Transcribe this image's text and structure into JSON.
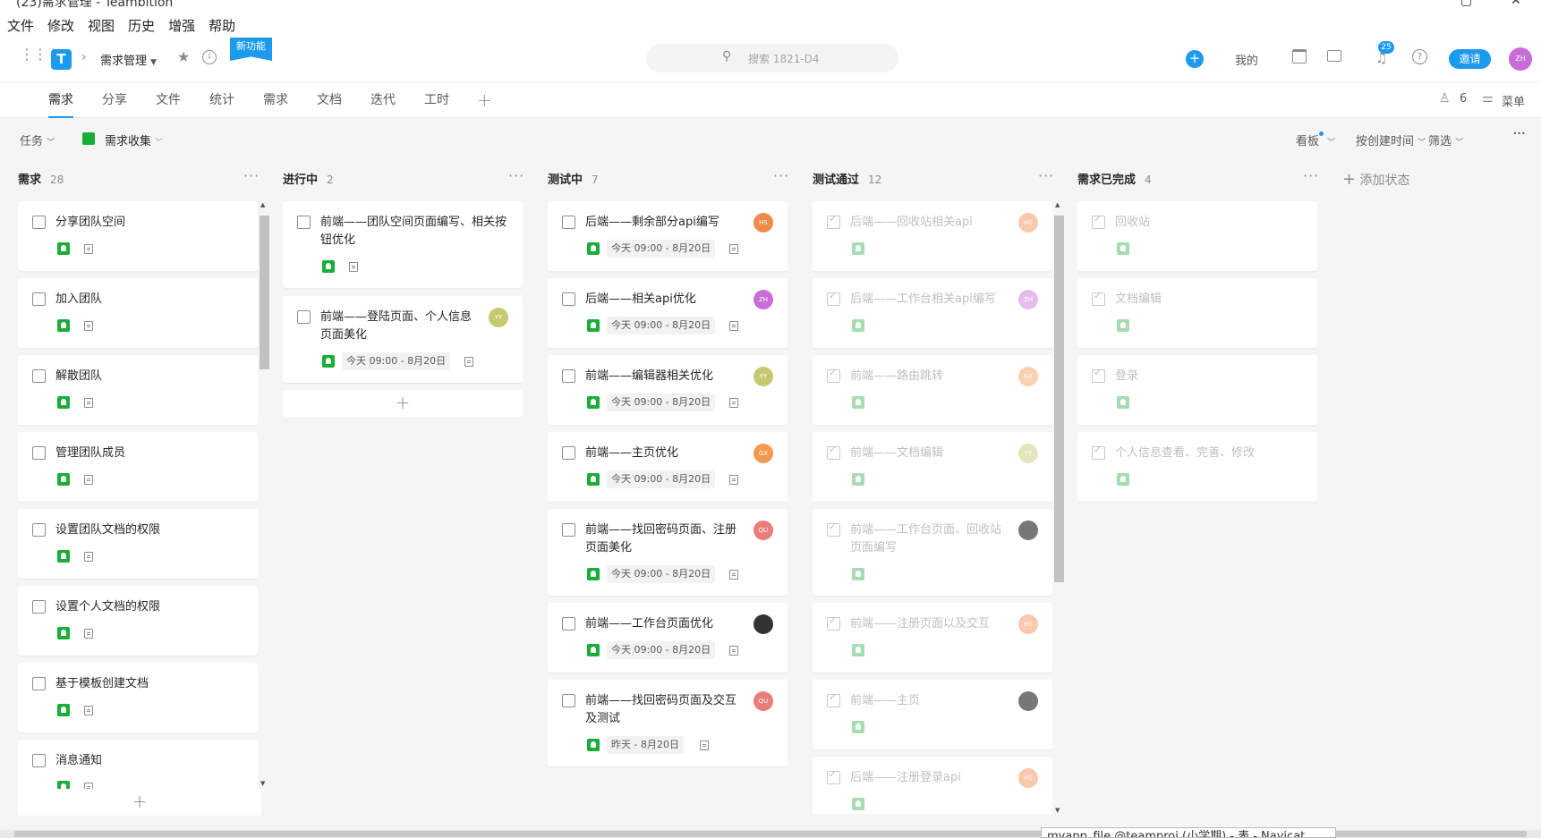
{
  "window": {
    "title": "(23)需求管理 - Teambition"
  },
  "menu": [
    "文件",
    "修改",
    "视图",
    "历史",
    "增强",
    "帮助"
  ],
  "header": {
    "project": "需求管理",
    "new_feature": "新功能",
    "search_placeholder": "搜索 1821-D4",
    "mine": "我的",
    "notification_count": "25",
    "invite": "邀请",
    "avatar": "ZH"
  },
  "tabs": [
    "需求",
    "分享",
    "文件",
    "统计",
    "需求",
    "文档",
    "迭代",
    "工时"
  ],
  "tab_right": {
    "members_count": "6",
    "menu_label": "菜单"
  },
  "toolbar": {
    "task_label": "任务",
    "collection_label": "需求收集",
    "view_label": "看板",
    "sort_label": "按创建时间",
    "filter_label": "筛选"
  },
  "add_status": "添加状态",
  "columns": [
    {
      "title": "需求",
      "count": "28",
      "cards": [
        {
          "title": "分享团队空间"
        },
        {
          "title": "加入团队"
        },
        {
          "title": "解散团队"
        },
        {
          "title": "管理团队成员"
        },
        {
          "title": "设置团队文档的权限"
        },
        {
          "title": "设置个人文档的权限"
        },
        {
          "title": "基于模板创建文档"
        },
        {
          "title": "消息通知"
        }
      ]
    },
    {
      "title": "进行中",
      "count": "2",
      "cards": [
        {
          "title": "前端——团队空间页面编写、相关按钮优化"
        },
        {
          "title": "前端——登陆页面、个人信息页面美化",
          "avatar": "YY",
          "date": "今天 09:00 - 8月20日"
        }
      ]
    },
    {
      "title": "测试中",
      "count": "7",
      "cards": [
        {
          "title": "后端——剩余部分api编写",
          "avatar": "HS",
          "date": "今天 09:00 - 8月20日"
        },
        {
          "title": "后端——相关api优化",
          "avatar": "ZH",
          "date": "今天 09:00 - 8月20日"
        },
        {
          "title": "前端——编辑器相关优化",
          "avatar": "YY",
          "date": "今天 09:00 - 8月20日"
        },
        {
          "title": "前端——主页优化",
          "avatar": "GX",
          "date": "今天 09:00 - 8月20日"
        },
        {
          "title": "前端——找回密码页面、注册页面美化",
          "avatar": "QU",
          "date": "今天 09:00 - 8月20日"
        },
        {
          "title": "前端——工作台页面优化",
          "avatar": "",
          "date": "今天 09:00 - 8月20日"
        },
        {
          "title": "前端——找回密码页面及交互及测试",
          "avatar": "QU",
          "date": "昨天 - 8月20日"
        }
      ]
    },
    {
      "title": "测试通过",
      "count": "12",
      "cards": [
        {
          "title": "后端——回收站相关api",
          "avatar": "HS"
        },
        {
          "title": "后端——工作台相关api编写",
          "avatar": "ZH"
        },
        {
          "title": "前端——路由跳转",
          "avatar": "GX"
        },
        {
          "title": "前端——文档编辑",
          "avatar": "YY"
        },
        {
          "title": "前端——工作台页面、回收站页面编写",
          "avatar": ""
        },
        {
          "title": "前端——注册页面以及交互",
          "avatar": "HS"
        },
        {
          "title": "前端——主页",
          "avatar": ""
        },
        {
          "title": "后端——注册登录api",
          "avatar": "HS"
        }
      ]
    },
    {
      "title": "需求已完成",
      "count": "4",
      "cards": [
        {
          "title": "回收站"
        },
        {
          "title": "文档编辑"
        },
        {
          "title": "登录"
        },
        {
          "title": "个人信息查看、完善、修改"
        }
      ]
    }
  ],
  "taskbar_hint": "myapp_file @teamproj (小学期) - 表 - Navicat",
  "colors": {
    "accent": "#1b9aee",
    "green": "#1aae39",
    "HS": "#f08a4b",
    "ZH": "#c86dd7",
    "YY": "#c6c96e",
    "GX": "#f39a4e",
    "QU": "#ec7c7c",
    "photo": "#555555"
  }
}
